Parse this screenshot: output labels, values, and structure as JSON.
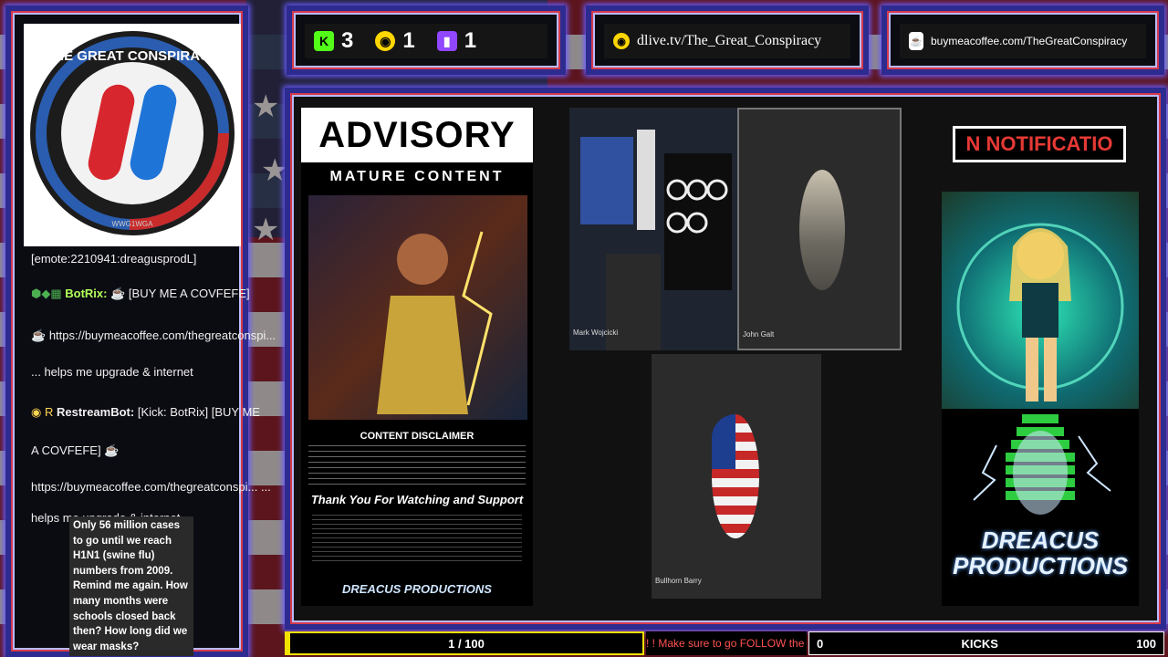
{
  "stats": {
    "kick_count": "3",
    "dlive_count": "1",
    "twitch_count": "1",
    "dlive_url": "dlive.tv/The_Great_Conspiracy",
    "bmc_url": "buymeacoffee.com/TheGreatConspiracy"
  },
  "logo": {
    "title": "THE GREAT CONSPIRACY",
    "motto": "WWG1WGA"
  },
  "chat": [
    {
      "user": "",
      "text": "[emote:2210941:dreagusprodL]"
    },
    {
      "user": "BotRix:",
      "text": "[BUY ME A COVFEFE]"
    },
    {
      "user": "",
      "text": "https://buymeacoffee.com/thegreatconspi..."
    },
    {
      "user": "",
      "text": "... helps me upgrade & internet"
    },
    {
      "user": "RestreamBot:",
      "text": "[Kick: BotRix] [BUY ME"
    },
    {
      "user": "",
      "text": "A COVFEFE]"
    },
    {
      "user": "",
      "text": "https://buymeacoffee.com/thegreatconspi... ..."
    },
    {
      "user": "",
      "text": "helps me upgrade & internet"
    }
  ],
  "bubble_text": "Only 56 million cases to go until we reach H1N1 (swine flu) numbers from 2009. Remind me again. How many months were schools closed back then? How long did we wear masks?",
  "advisory": {
    "title": "ADVISORY",
    "subtitle": "MATURE CONTENT",
    "disclaimer_title": "CONTENT DISCLAIMER",
    "thanks": "Thank You For Watching and Support",
    "brand": "DREACUS PRODUCTIONS"
  },
  "cams": {
    "cam1_label": "Mark Wojcicki",
    "cam2_label": "John Galt",
    "cam3_label": "Bullhorn Barry"
  },
  "notification": "N NOTIFICATIO",
  "brand_right": "DREACUS PRODUCTIONS",
  "progress": "1 / 100",
  "ticker": "! ! Make sure to go FOLLOW the",
  "kicks": {
    "min": "0",
    "label": "KICKS",
    "max": "100"
  },
  "colors": {
    "accent_blue": "#2d2b8f",
    "accent_red": "#d53a4a",
    "kick_green": "#53fc18",
    "twitch_purple": "#9146ff"
  }
}
